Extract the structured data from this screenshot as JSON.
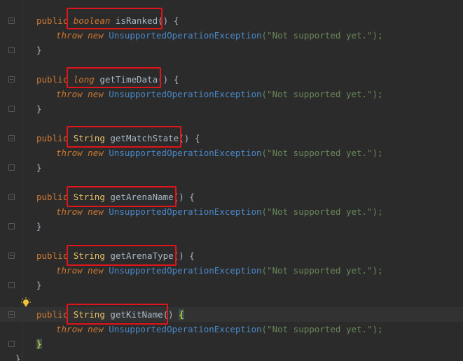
{
  "editor": {
    "methods": [
      {
        "modifier": "public",
        "return_type": "boolean",
        "return_kind": "primitive",
        "name": "isRanked",
        "parens": "()",
        "open_brace": "{",
        "throw_kw": "throw",
        "new_kw": "new",
        "exception": "UnsupportedOperationException",
        "message": "(\"Not supported yet.\");",
        "close_brace": "}"
      },
      {
        "modifier": "public",
        "return_type": "long",
        "return_kind": "primitive",
        "name": "getTimeData",
        "parens": "()",
        "open_brace": "{",
        "throw_kw": "throw",
        "new_kw": "new",
        "exception": "UnsupportedOperationException",
        "message": "(\"Not supported yet.\");",
        "close_brace": "}"
      },
      {
        "modifier": "public",
        "return_type": "String",
        "return_kind": "class",
        "name": "getMatchState",
        "parens": "()",
        "open_brace": "{",
        "throw_kw": "throw",
        "new_kw": "new",
        "exception": "UnsupportedOperationException",
        "message": "(\"Not supported yet.\");",
        "close_brace": "}"
      },
      {
        "modifier": "public",
        "return_type": "String",
        "return_kind": "class",
        "name": "getArenaName",
        "parens": "()",
        "open_brace": "{",
        "throw_kw": "throw",
        "new_kw": "new",
        "exception": "UnsupportedOperationException",
        "message": "(\"Not supported yet.\");",
        "close_brace": "}"
      },
      {
        "modifier": "public",
        "return_type": "String",
        "return_kind": "class",
        "name": "getArenaType",
        "parens": "()",
        "open_brace": "{",
        "throw_kw": "throw",
        "new_kw": "new",
        "exception": "UnsupportedOperationException",
        "message": "(\"Not supported yet.\");",
        "close_brace": "}"
      },
      {
        "modifier": "public",
        "return_type": "String",
        "return_kind": "class",
        "name": "getKitName",
        "parens": "()",
        "open_brace": "{",
        "throw_kw": "throw",
        "new_kw": "new",
        "exception": "UnsupportedOperationException",
        "message": "(\"Not supported yet.\");",
        "close_brace": "}"
      }
    ],
    "class_close_brace": "}",
    "highlight_color": "#e0151b",
    "icons": {
      "intention": "lightbulb-icon",
      "fold": "fold-marker-icon"
    }
  }
}
